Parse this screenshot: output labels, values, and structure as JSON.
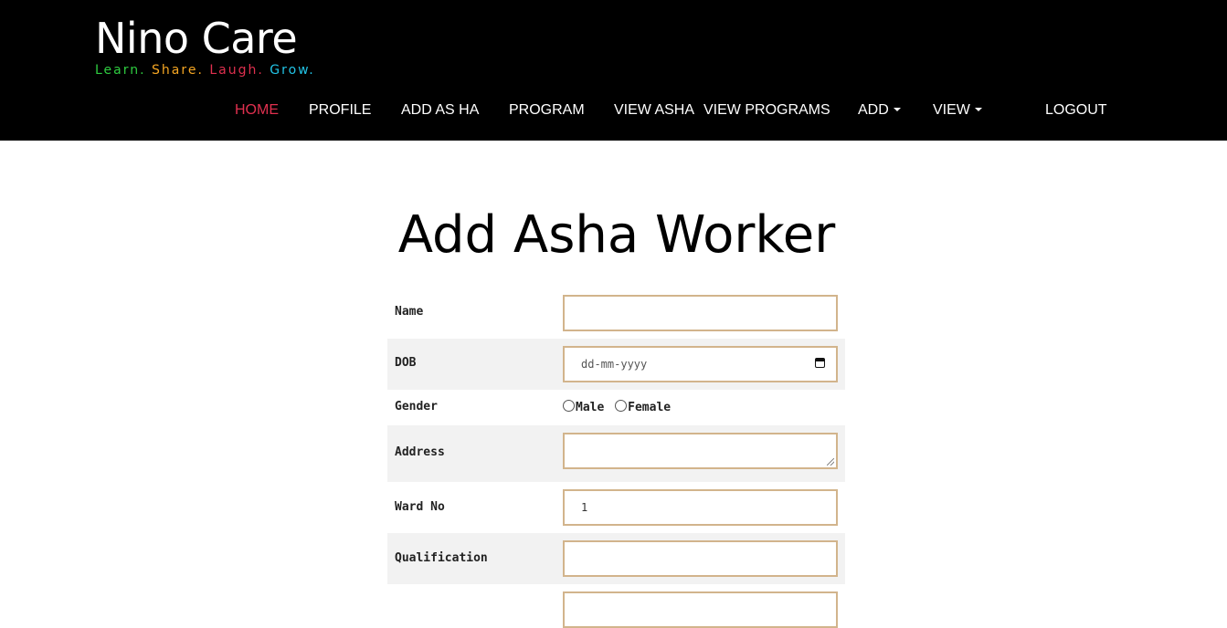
{
  "header": {
    "brand": "Nino Care",
    "tagline": [
      {
        "text": "Learn.",
        "color": "#2ecc40"
      },
      {
        "text": "Share.",
        "color": "#f5a623"
      },
      {
        "text": "Laugh.",
        "color": "#e0304f"
      },
      {
        "text": "Grow.",
        "color": "#22c4e6"
      }
    ],
    "nav": {
      "home": "HOME",
      "profile": "PROFILE",
      "add_asha": "ADD AS HA",
      "program": "PROGRAM",
      "view_asha": "VIEW ASHA",
      "view_programs": "VIEW PROGRAMS",
      "add": "ADD",
      "view": "VIEW",
      "logout": "LOGOUT",
      "active_color": "#e0304f"
    }
  },
  "main": {
    "title": "Add Asha Worker",
    "form": {
      "name_label": "Name",
      "name_value": "",
      "dob_label": "DOB",
      "dob_placeholder": "dd-mm-yyyy",
      "gender_label": "Gender",
      "gender_options": [
        "Male",
        "Female"
      ],
      "address_label": "Address",
      "address_value": "",
      "ward_label": "Ward No",
      "ward_value": "1",
      "qualification_label": "Qualification",
      "qualification_value": "",
      "field_border_color": "#d2b48c"
    }
  }
}
